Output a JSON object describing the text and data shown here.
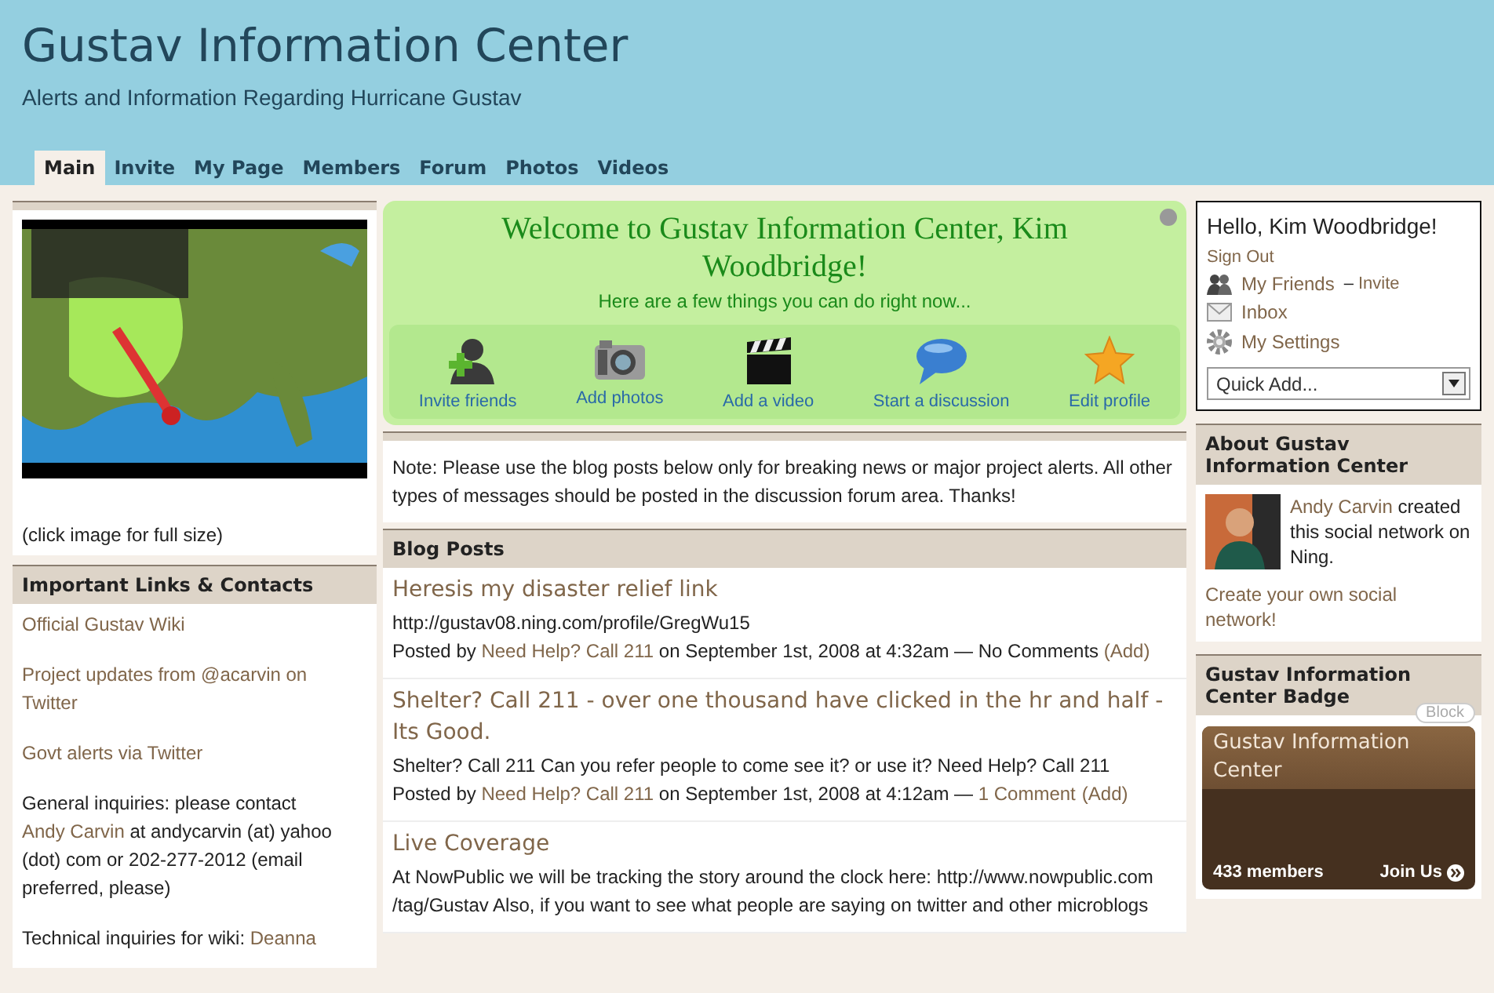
{
  "header": {
    "title": "Gustav Information Center",
    "subtitle": "Alerts and Information Regarding Hurricane Gustav"
  },
  "tabs": [
    {
      "label": "Main",
      "selected": true
    },
    {
      "label": "Invite",
      "selected": false
    },
    {
      "label": "My Page",
      "selected": false
    },
    {
      "label": "Members",
      "selected": false
    },
    {
      "label": "Forum",
      "selected": false
    },
    {
      "label": "Photos",
      "selected": false
    },
    {
      "label": "Videos",
      "selected": false
    }
  ],
  "left": {
    "map_caption": "(click image for full size)",
    "links_title": "Important Links & Contacts",
    "paragraphs": [
      [
        {
          "text": "Official Gustav Wiki",
          "link": true
        }
      ],
      [
        {
          "text": "Project updates from @acarvin on Twitter",
          "link": true
        }
      ],
      [
        {
          "text": "Govt alerts via Twitter",
          "link": true
        }
      ],
      [
        {
          "text": "General inquiries: please contact ",
          "link": false
        },
        {
          "text": "Andy Carvin",
          "link": true
        },
        {
          "text": " at andycarvin (at) yahoo (dot) com or 202-277-2012 (email preferred, please)",
          "link": false
        }
      ],
      [
        {
          "text": "Technical inquiries for wiki: ",
          "link": false
        },
        {
          "text": "Deanna",
          "link": true
        }
      ]
    ]
  },
  "welcome": {
    "title": "Welcome to Gustav Information Center, Kim Woodbridge!",
    "subtitle": "Here are a few things you can do right now...",
    "actions": [
      {
        "kind": "invite",
        "label": "Invite friends"
      },
      {
        "kind": "photos",
        "label": "Add photos"
      },
      {
        "kind": "video",
        "label": "Add a video"
      },
      {
        "kind": "discussion",
        "label": "Start a discussion"
      },
      {
        "kind": "profile",
        "label": "Edit profile"
      }
    ]
  },
  "note": "Note: Please use the blog posts below only for breaking news or major project alerts. All other types of messages should be posted in the discussion forum area. Thanks!",
  "blog": {
    "title": "Blog Posts",
    "posts": [
      {
        "title": "Heresis my disaster relief link",
        "body": "http://gustav08.ning.com/profile/GregWu15",
        "meta": [
          {
            "text": "Posted by ",
            "link": false
          },
          {
            "text": "Need Help? Call 211",
            "link": true
          },
          {
            "text": " on September 1st, 2008 at 4:32am — No Comments ",
            "link": false
          },
          {
            "text": "(Add)",
            "link": true
          }
        ]
      },
      {
        "title": "Shelter? Call 211 - over one thousand have clicked in the hr and half - Its Good.",
        "body": "Shelter? Call 211 Can you refer people to come see it? or use it? Need Help? Call 211",
        "meta": [
          {
            "text": "Posted by ",
            "link": false
          },
          {
            "text": "Need Help? Call 211",
            "link": true
          },
          {
            "text": " on September 1st, 2008 at 4:12am — ",
            "link": false
          },
          {
            "text": "1 Comment",
            "link": true
          },
          {
            "text": "(Add)",
            "link": true
          }
        ]
      },
      {
        "title": "Live Coverage",
        "body": "At NowPublic we will be tracking the story around the clock here: http://www.nowpublic.com /tag/Gustav Also, if you want to see what people are saying on twitter and other microblogs"
      }
    ]
  },
  "user": {
    "greeting": "Hello, Kim Woodbridge!",
    "sign_out": "Sign Out",
    "links": [
      {
        "kind": "friends",
        "label": "My Friends",
        "separator": "–",
        "extra": "Invite"
      },
      {
        "kind": "inbox",
        "label": "Inbox"
      },
      {
        "kind": "settings",
        "label": "My Settings"
      }
    ],
    "quick_add": "Quick Add..."
  },
  "about": {
    "title": "About Gustav Information Center",
    "creator": "Andy Carvin",
    "created_text": " created this social network on Ning.",
    "create_link": "Create your own social network!"
  },
  "badge": {
    "title": "Gustav Information Center Badge",
    "block": "Block",
    "name": "Gustav Information Center",
    "members": "433 members",
    "join": "Join Us"
  }
}
